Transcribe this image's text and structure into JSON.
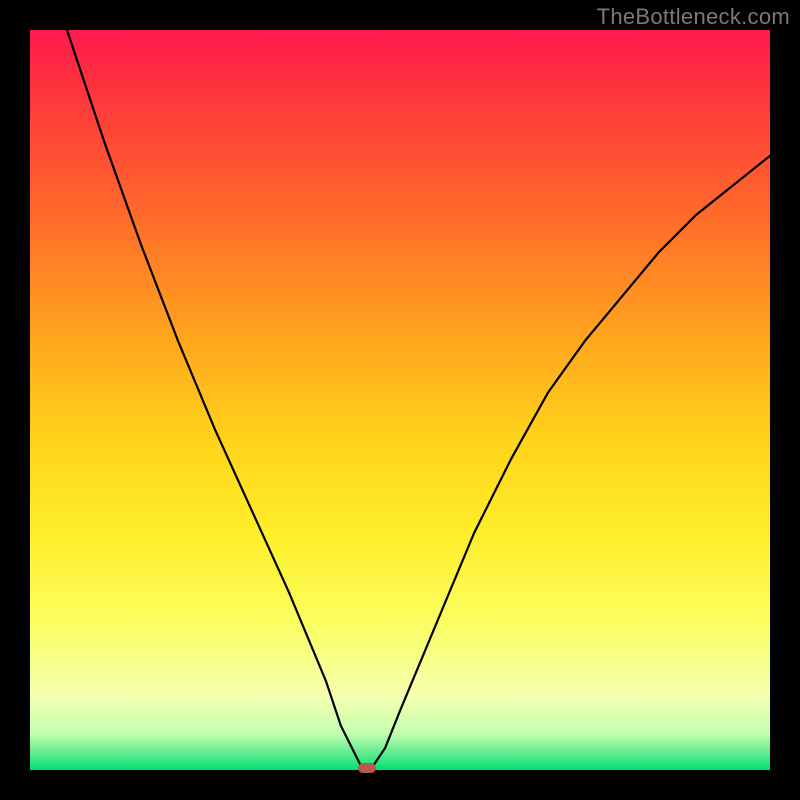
{
  "watermark": "TheBottleneck.com",
  "chart_data": {
    "type": "line",
    "title": "",
    "xlabel": "",
    "ylabel": "",
    "xlim": [
      0,
      100
    ],
    "ylim": [
      0,
      100
    ],
    "grid": false,
    "legend": false,
    "background": "red-yellow-green vertical gradient",
    "series": [
      {
        "name": "bottleneck-curve",
        "x": [
          0,
          5,
          10,
          15,
          20,
          25,
          30,
          35,
          40,
          42,
          44,
          45,
          46,
          48,
          50,
          55,
          60,
          65,
          70,
          75,
          80,
          85,
          90,
          95,
          100
        ],
        "values": [
          115,
          100,
          85,
          71,
          58,
          46,
          35,
          24,
          12,
          6,
          2,
          0,
          0,
          3,
          8,
          20,
          32,
          42,
          51,
          58,
          64,
          70,
          75,
          79,
          83
        ]
      }
    ],
    "marker": {
      "x": 45.5,
      "y": 0,
      "color": "#b6594f"
    }
  },
  "colors": {
    "frame": "#000000",
    "curve": "#000000",
    "gradient_top": "#ff1a4d",
    "gradient_mid": "#ffee2a",
    "gradient_bottom": "#00e070"
  }
}
